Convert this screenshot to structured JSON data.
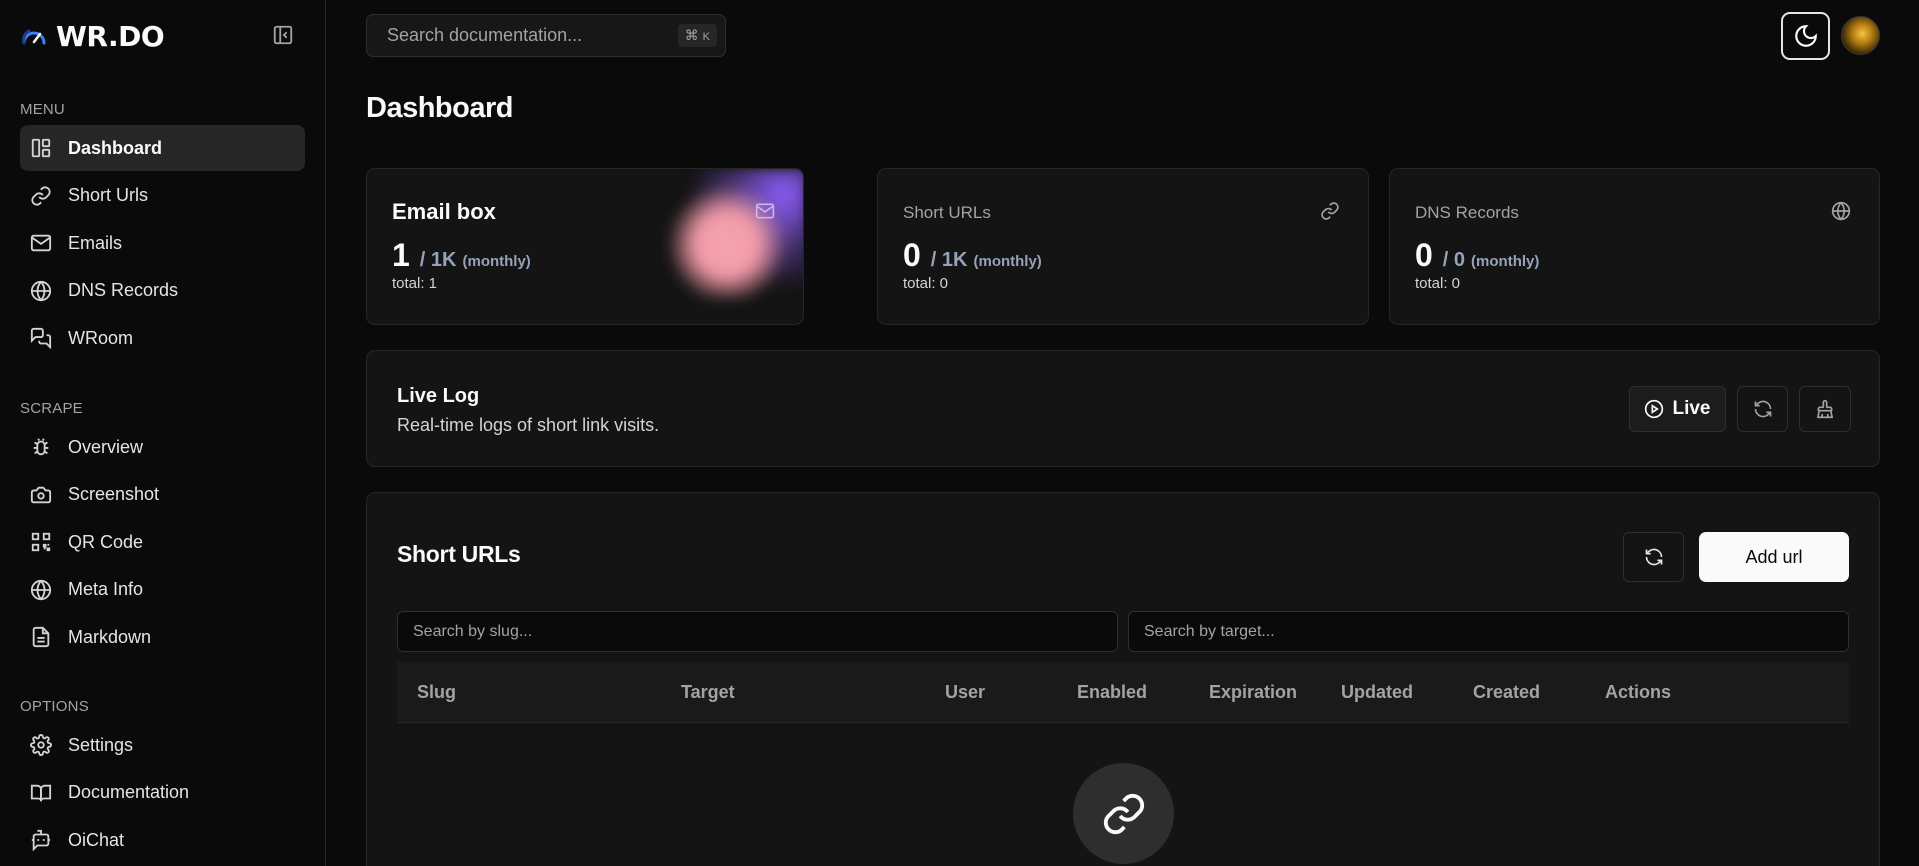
{
  "brand": {
    "name": "WR.DO"
  },
  "sidebar": {
    "sections": [
      {
        "label": "MENU",
        "items": [
          {
            "label": "Dashboard",
            "icon": "dashboard-icon",
            "active": true
          },
          {
            "label": "Short Urls",
            "icon": "link-icon"
          },
          {
            "label": "Emails",
            "icon": "mail-icon"
          },
          {
            "label": "DNS Records",
            "icon": "globe-lock-icon"
          },
          {
            "label": "WRoom",
            "icon": "chat-icon"
          }
        ]
      },
      {
        "label": "SCRAPE",
        "items": [
          {
            "label": "Overview",
            "icon": "bug-icon"
          },
          {
            "label": "Screenshot",
            "icon": "camera-icon"
          },
          {
            "label": "QR Code",
            "icon": "qr-code-icon"
          },
          {
            "label": "Meta Info",
            "icon": "globe-icon"
          },
          {
            "label": "Markdown",
            "icon": "file-text-icon"
          }
        ]
      },
      {
        "label": "OPTIONS",
        "items": [
          {
            "label": "Settings",
            "icon": "gear-icon"
          },
          {
            "label": "Documentation",
            "icon": "book-icon"
          },
          {
            "label": "OiChat",
            "icon": "bot-icon"
          }
        ]
      }
    ]
  },
  "topbar": {
    "search_placeholder": "Search documentation...",
    "shortcut_symbol": "⌘",
    "shortcut_key": "K"
  },
  "page": {
    "title": "Dashboard"
  },
  "stats": {
    "email": {
      "title": "Email box",
      "value": "1",
      "limit": "/ 1K",
      "period": "(monthly)",
      "total": "total: 1"
    },
    "short_urls": {
      "title": "Short URLs",
      "value": "0",
      "limit": "/ 1K",
      "period": "(monthly)",
      "total": "total: 0"
    },
    "dns": {
      "title": "DNS Records",
      "value": "0",
      "limit": "/ 0",
      "period": "(monthly)",
      "total": "total: 0"
    }
  },
  "live_log": {
    "title": "Live Log",
    "description": "Real-time logs of short link visits.",
    "live_label": "Live"
  },
  "short_urls": {
    "title": "Short URLs",
    "add_label": "Add url",
    "slug_placeholder": "Search by slug...",
    "target_placeholder": "Search by target...",
    "columns": [
      "Slug",
      "Target",
      "User",
      "Enabled",
      "Expiration",
      "Updated",
      "Created",
      "Actions"
    ]
  },
  "colors": {
    "background": "#0a0a0a",
    "card": "#141414",
    "border": "#262626",
    "muted": "#a3a3a3",
    "accent_number": "#94a3b8"
  }
}
